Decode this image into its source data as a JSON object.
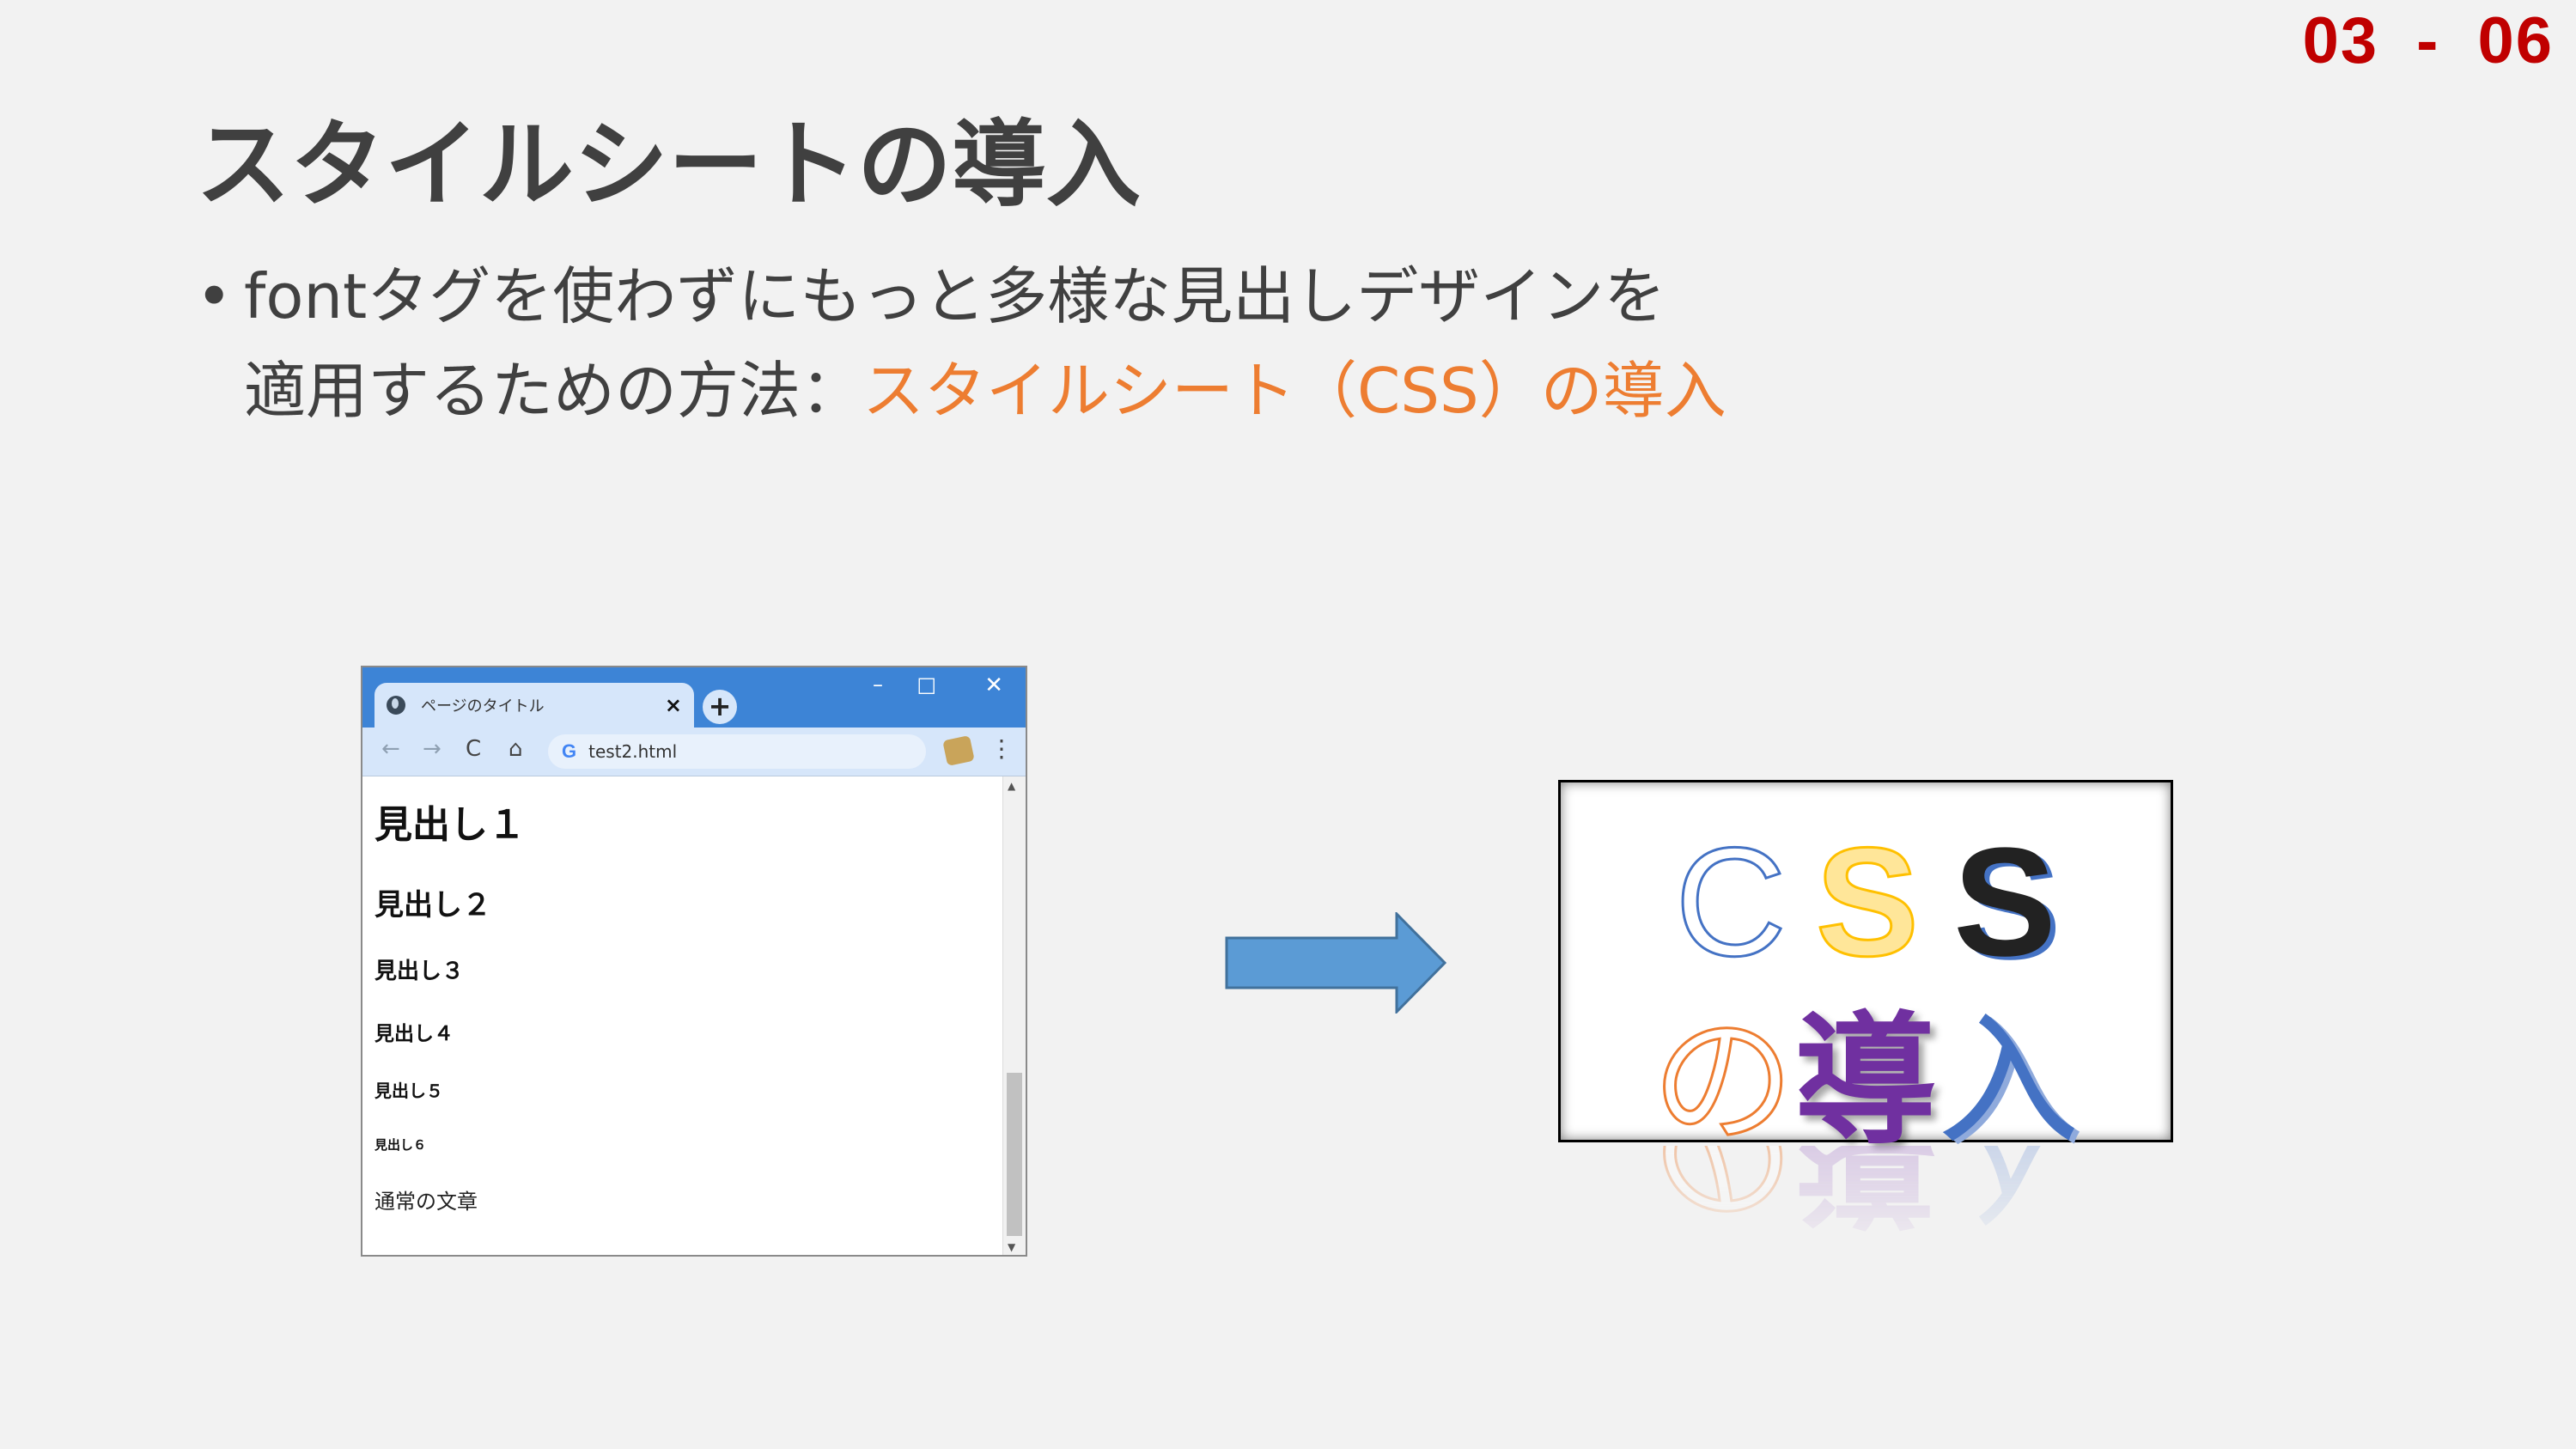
{
  "page_number": {
    "left": "03",
    "dash": "-",
    "right": "06"
  },
  "title": "スタイルシートの導入",
  "bullet": {
    "marker": "•",
    "line1": "fontタグを使わずにもっと多様な見出しデザインを",
    "line2_plain": "適用するための方法：",
    "line2_highlight": "スタイルシート（CSS）の導入",
    "highlight_color": "#ed7d31"
  },
  "browser": {
    "tab_title": "ページのタイトル",
    "tab_close": "×",
    "new_tab": "+",
    "window_controls": {
      "minimize": "–",
      "maximize": "□",
      "close": "✕"
    },
    "nav": {
      "back": "←",
      "forward": "→",
      "reload": "C",
      "home": "⌂",
      "menu": "⋮"
    },
    "address_icon": "G",
    "url": "test2.html",
    "headings": [
      "見出し１",
      "見出し２",
      "見出し３",
      "見出し４",
      "見出し５",
      "見出し６"
    ],
    "body_text": "通常の文章",
    "scroll_up": "▲",
    "scroll_down": "▼",
    "accent_color": "#3d84d6"
  },
  "arrow": {
    "color": "#5b9bd5",
    "icon": "right-arrow"
  },
  "css_logo": {
    "row1": [
      "C",
      "S",
      "S"
    ],
    "row2": [
      "の",
      "導",
      "入"
    ],
    "colors": {
      "c": "#4472c4",
      "s1": "#ffc000",
      "s2": "#222222",
      "no": "#ed7d31",
      "dou": "#7030a0",
      "nyu": "#4472c4"
    }
  }
}
